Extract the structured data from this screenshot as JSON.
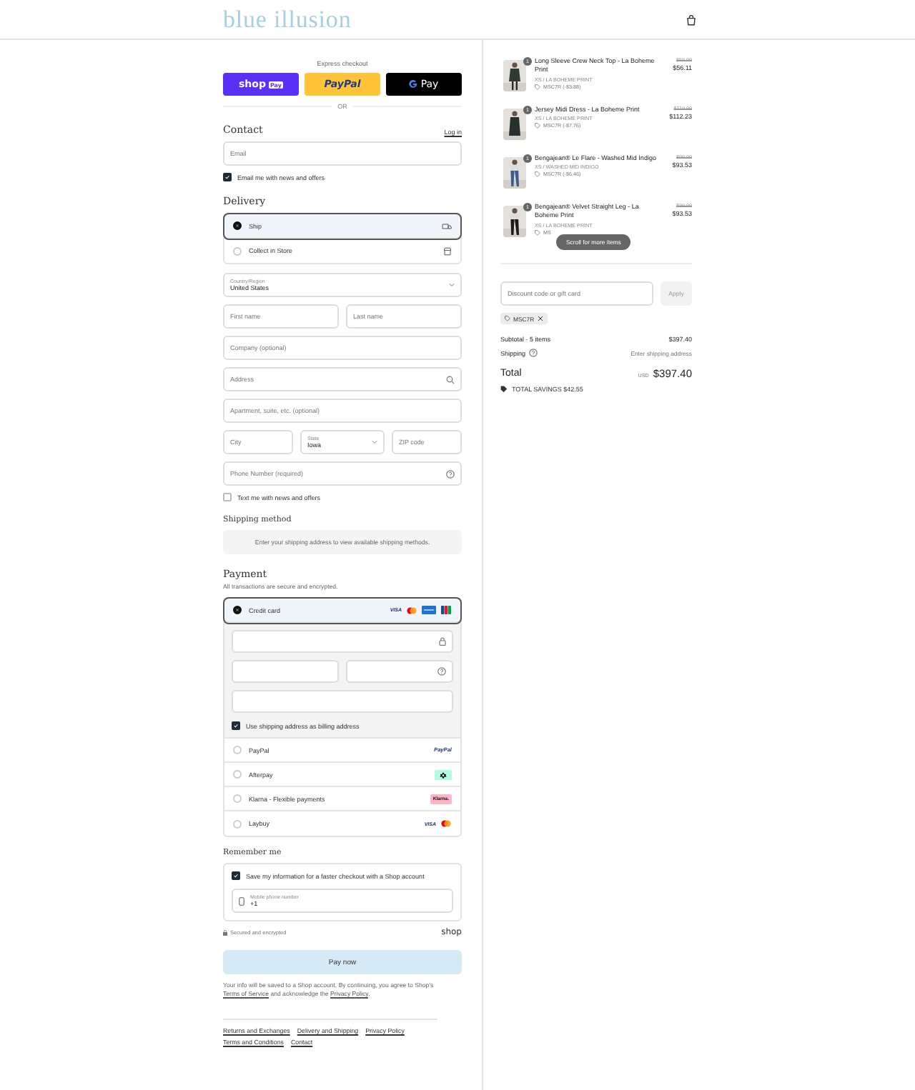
{
  "header": {
    "logo": "blue illusion"
  },
  "express_checkout": {
    "label": "Express checkout",
    "buttons": [
      {
        "kind": "shoppay",
        "text": "shop",
        "badge": "Pay"
      },
      {
        "kind": "paypal",
        "text": "PayPal"
      },
      {
        "kind": "gpay",
        "text": "Pay"
      }
    ],
    "divider": "OR"
  },
  "contact": {
    "heading": "Contact",
    "login": "Log in",
    "email": {
      "placeholder": "Email"
    },
    "newsletter": {
      "label": "Email me with news and offers",
      "checked": true
    }
  },
  "delivery": {
    "heading": "Delivery",
    "options": [
      {
        "kind": "ship",
        "label": "Ship",
        "selected": true
      },
      {
        "kind": "store",
        "label": "Collect in Store",
        "selected": false
      }
    ],
    "rows": [
      {
        "fields": [
          {
            "kind": "select",
            "label": "Country/Region",
            "value": "United States"
          }
        ]
      },
      {
        "fields": [
          {
            "kind": "text",
            "placeholder": "First name"
          },
          {
            "kind": "text",
            "placeholder": "Last name"
          }
        ]
      },
      {
        "fields": [
          {
            "kind": "text",
            "placeholder": "Company (optional)"
          }
        ]
      },
      {
        "fields": [
          {
            "kind": "search",
            "placeholder": "Address"
          }
        ]
      },
      {
        "fields": [
          {
            "kind": "text",
            "placeholder": "Apartment, suite, etc. (optional)"
          }
        ]
      },
      {
        "fields": [
          {
            "kind": "text",
            "placeholder": "City"
          },
          {
            "kind": "select",
            "label": "State",
            "value": "Iowa"
          },
          {
            "kind": "text",
            "placeholder": "ZIP code"
          }
        ]
      },
      {
        "fields": [
          {
            "kind": "help",
            "placeholder": "Phone Number (required)"
          }
        ]
      }
    ],
    "sms": {
      "label": "Text me with news and offers",
      "checked": false
    }
  },
  "shipping_method": {
    "heading": "Shipping method",
    "message": "Enter your shipping address to view available shipping methods."
  },
  "payment": {
    "heading": "Payment",
    "subtitle": "All transactions are secure and encrypted.",
    "methods": [
      {
        "kind": "card",
        "label": "Credit card",
        "selected": true,
        "logos": [
          {
            "kind": "visa",
            "text": "VISA"
          },
          {
            "kind": "mastercard"
          },
          {
            "kind": "amex"
          },
          {
            "kind": "jcb"
          }
        ]
      },
      {
        "kind": "other",
        "label": "PayPal",
        "selected": false,
        "logos": [
          {
            "kind": "paypal",
            "text": "PayPal"
          }
        ]
      },
      {
        "kind": "other",
        "label": "Afterpay",
        "selected": false,
        "logos": [
          {
            "kind": "afterpay"
          }
        ]
      },
      {
        "kind": "other",
        "label": "Klarna - Flexible payments",
        "selected": false,
        "logos": [
          {
            "kind": "klarna",
            "text": "Klarna."
          }
        ]
      },
      {
        "kind": "other",
        "label": "Laybuy",
        "selected": false,
        "logos": [
          {
            "kind": "visa",
            "text": "VISA"
          },
          {
            "kind": "mastercard"
          }
        ]
      }
    ],
    "card_form": {
      "rows": [
        {
          "fields": [
            {
              "kind": "lock"
            }
          ]
        },
        {
          "fields": [
            {
              "kind": "plain"
            },
            {
              "kind": "help"
            }
          ]
        },
        {
          "fields": [
            {
              "kind": "plain"
            }
          ]
        }
      ],
      "billing": {
        "label": "Use shipping address as billing address",
        "checked": true
      }
    }
  },
  "remember": {
    "heading": "Remember me",
    "save": {
      "label": "Save my information for a faster checkout with a Shop account",
      "checked": true
    },
    "phone": {
      "label": "Mobile phone number",
      "value": "+1"
    },
    "secure": "Secured and encrypted",
    "brand": "shop"
  },
  "pay_button": "Pay now",
  "legal": [
    {
      "kind": "text",
      "text": "Your info will be saved to a Shop account. By continuing, you agree to Shop’s "
    },
    {
      "kind": "link",
      "text": "Terms of Service"
    },
    {
      "kind": "text",
      "text": " and acknowledge the "
    },
    {
      "kind": "link",
      "text": "Privacy Policy"
    },
    {
      "kind": "text",
      "text": "."
    }
  ],
  "footer_links": [
    "Returns and Exchanges",
    "Delivery and Shipping",
    "Privacy Policy",
    "Terms and Conditions",
    "Contact"
  ],
  "summary": {
    "items": [
      {
        "title": "Long Sleeve Crew Neck Top - La Boheme Print",
        "variant": "XS / LA BOHEME PRINT",
        "discount": "MSC7R (-$3.88)",
        "original_price": "$59.99",
        "price": "$56.11",
        "quantity": "1"
      },
      {
        "title": "Jersey Midi Dress - La Boheme Print",
        "variant": "XS / LA BOHEME PRINT",
        "discount": "MSC7R (-$7.76)",
        "original_price": "$119.99",
        "price": "$112.23",
        "quantity": "1"
      },
      {
        "title": "Bengajean® Le Flare - Washed Mid Indigo",
        "variant": "XS / WASHED MID INDIGO",
        "discount": "MSC7R (-$6.46)",
        "original_price": "$99.99",
        "price": "$93.53",
        "quantity": "1"
      },
      {
        "title": "Bengajean® Velvet Straight Leg - La Boheme Print",
        "variant": "XS / LA BOHEME PRINT",
        "discount": "MS",
        "original_price": "$99.99",
        "price": "$93.53",
        "quantity": "1"
      }
    ],
    "scroll_hint": "Scroll for more items",
    "discount_field": {
      "placeholder": "Discount code or gift card",
      "button": "Apply"
    },
    "codes": [
      {
        "code": "MSC7R"
      }
    ],
    "subtotal_label": "Subtotal · 5 items",
    "subtotal": "$397.40",
    "shipping_label": "Shipping",
    "shipping_value": "Enter shipping address",
    "total_label": "Total",
    "currency": "USD",
    "total": "$397.40",
    "savings": "TOTAL SAVINGS $42.55"
  }
}
